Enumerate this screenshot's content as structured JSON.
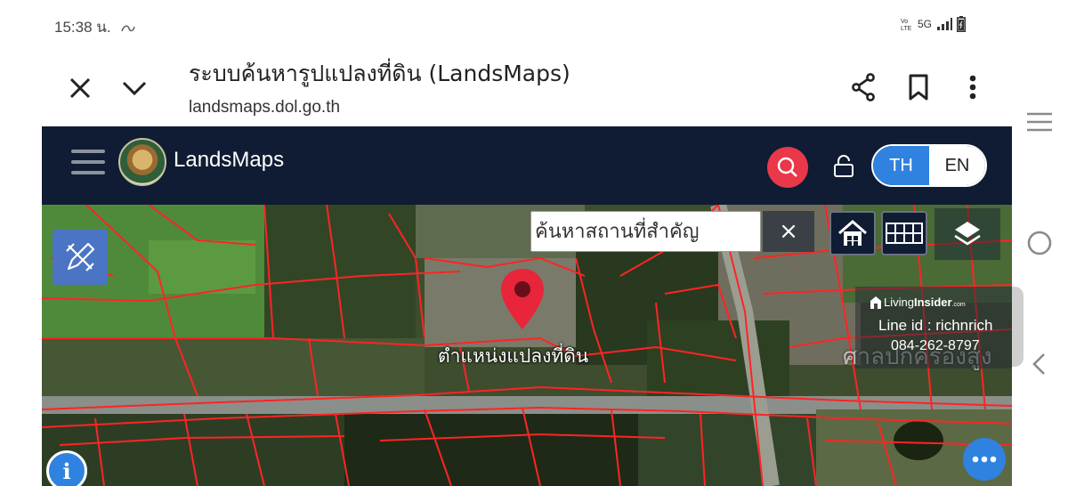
{
  "status_bar": {
    "time": "15:38 น.",
    "network": "5G",
    "volte": "Vo0 LTE",
    "icons": [
      "sync-icon",
      "signal-icon",
      "battery-icon"
    ]
  },
  "browser": {
    "page_title": "ระบบค้นหารูปแปลงที่ดิน (LandsMaps)",
    "url": "landsmaps.dol.go.th",
    "icons": [
      "close-icon",
      "chevron-down-icon",
      "share-icon",
      "bookmark-icon",
      "more-vert-icon"
    ]
  },
  "app": {
    "brand": "LandsMaps",
    "lang": {
      "th": "TH",
      "en": "EN",
      "active": "TH"
    },
    "accent": "#2f82e0",
    "header_bg": "#0f1c33",
    "search_color": "#e8384a"
  },
  "map": {
    "search_placeholder": "ค้นหาสถานที่สำคัญ",
    "clear_label": "×",
    "pin_label": "ตำแหน่งแปลงที่ดิน",
    "district_label": "ศาลปกครองสูง",
    "parcel_line_color": "#ff2020",
    "controls": [
      "draw-tool-icon",
      "home-icon",
      "grid-icon",
      "layers-icon",
      "info-icon",
      "more-horiz-icon"
    ]
  },
  "watermark": {
    "brand_light": "Living",
    "brand_bold": "Insider",
    "brand_suffix": ".com",
    "line_id": "Line id : richnrich",
    "phone": "084-262-8797"
  },
  "nav": {
    "icons": [
      "recents-icon",
      "home-circle-icon",
      "back-icon"
    ]
  }
}
